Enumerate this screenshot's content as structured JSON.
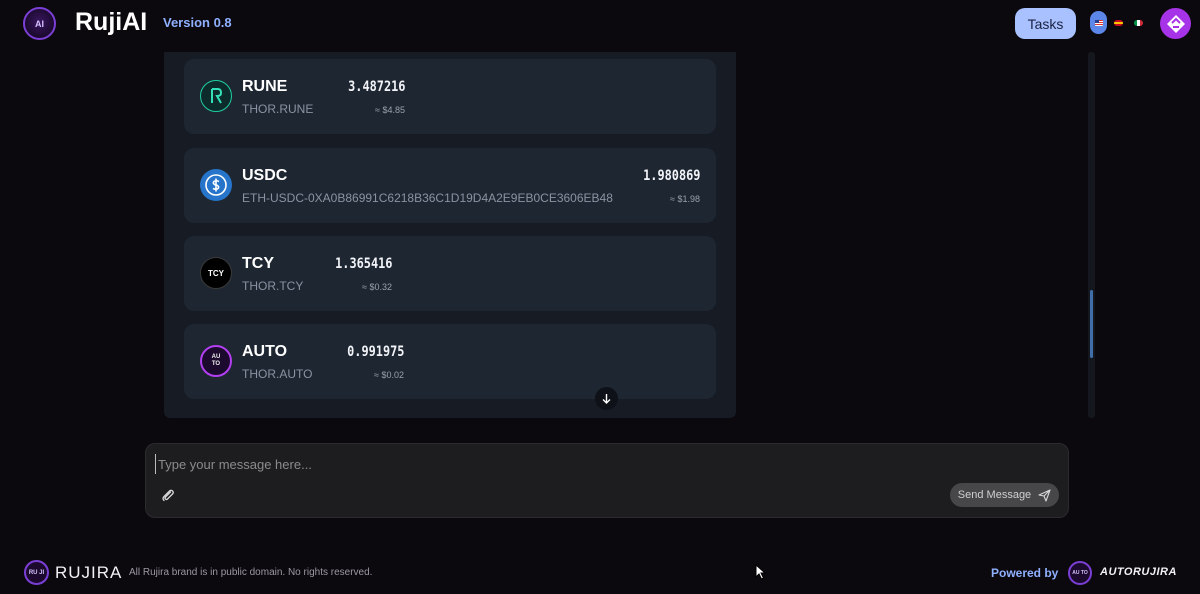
{
  "header": {
    "logo_text": "AI",
    "title": "RujiAI",
    "version": "Version 0.8",
    "tasks_label": "Tasks"
  },
  "tokens": [
    {
      "name": "RUNE",
      "id": "THOR.RUNE",
      "amount": "3.487216",
      "usd": "≈ $4.85",
      "icon": "rune-icon"
    },
    {
      "name": "USDC",
      "id": "ETH-USDC-0XA0B86991C6218B36C1D19D4A2E9EB0CE3606EB48",
      "amount": "1.980869",
      "usd": "≈ $1.98",
      "icon": "usdc-icon"
    },
    {
      "name": "TCY",
      "id": "THOR.TCY",
      "amount": "1.365416",
      "usd": "≈ $0.32",
      "icon": "tcy-icon"
    },
    {
      "name": "AUTO",
      "id": "THOR.AUTO",
      "amount": "0.991975",
      "usd": "≈ $0.02",
      "icon": "auto-icon"
    }
  ],
  "token_icon_labels": {
    "tcy": "TCY",
    "auto": "AU TO"
  },
  "composer": {
    "placeholder": "Type your message here...",
    "send_label": "Send Message"
  },
  "footer": {
    "brand": "RUJIRA",
    "logo_text": "RU JI",
    "copyright": "All Rujira brand is in public domain. No rights reserved.",
    "powered_by": "Powered by",
    "powered_brand": "AUTORUJIRA",
    "powered_logo_text": "AU TO"
  },
  "colors": {
    "background": "#0c090e",
    "panel": "#161b24",
    "card": "#1e2632",
    "accent_blue": "#8fb0ff",
    "tasks_button": "#a9c1ff",
    "purple": "#a733e8"
  }
}
